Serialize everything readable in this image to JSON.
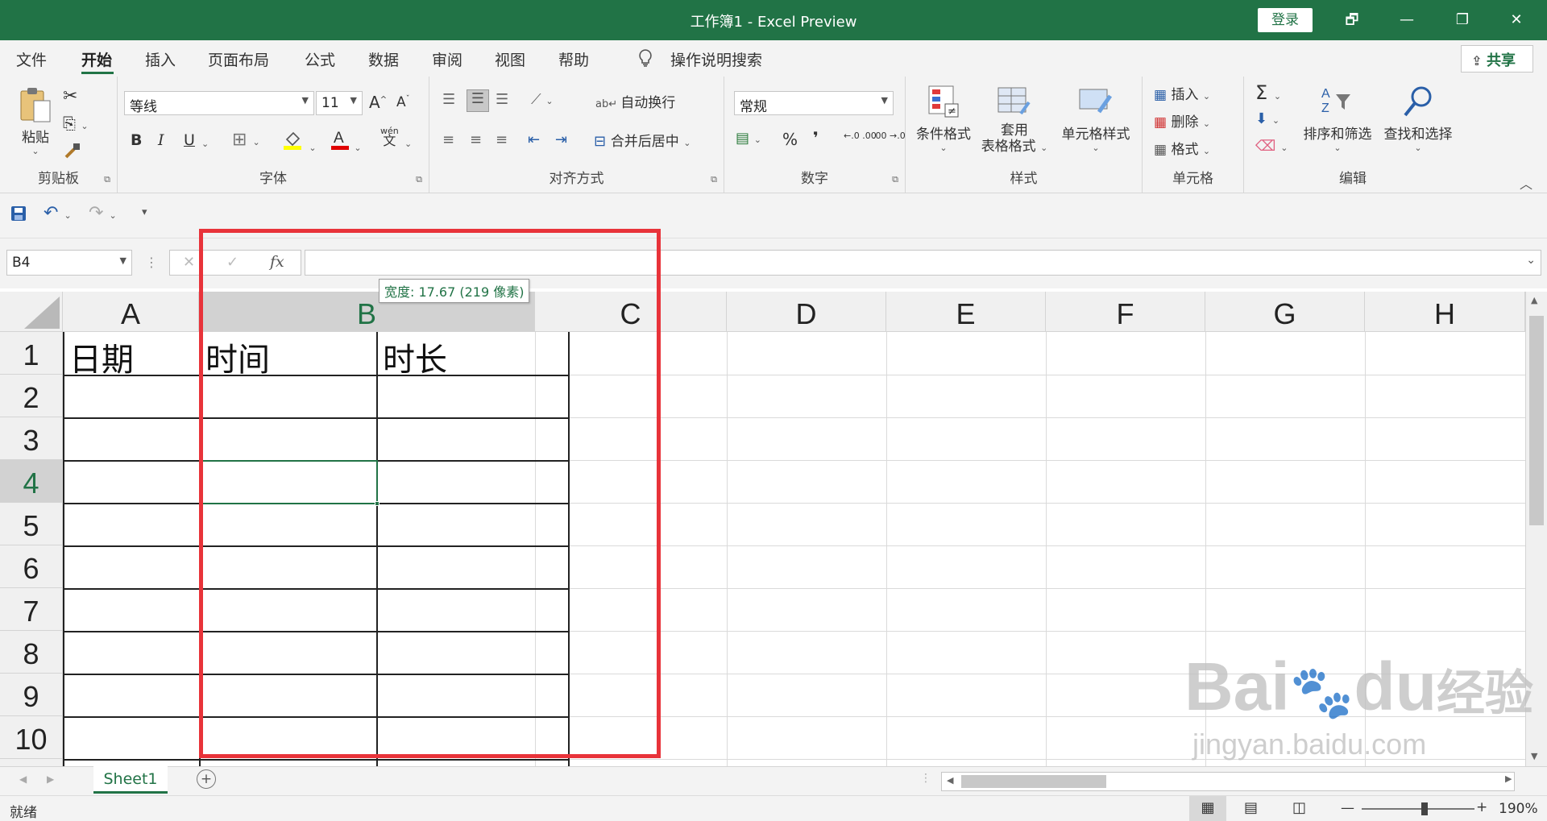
{
  "window": {
    "title": "工作簿1  -  Excel Preview",
    "login": "登录",
    "restore": "🗗",
    "minimize": "—",
    "maximize": "❐",
    "close": "✕"
  },
  "menu": {
    "tabs": [
      "文件",
      "开始",
      "插入",
      "页面布局",
      "公式",
      "数据",
      "审阅",
      "视图",
      "帮助"
    ],
    "active": "开始",
    "search_icon": "lightbulb-icon",
    "search_label": "操作说明搜索",
    "share": "共享"
  },
  "ribbon": {
    "clipboard": {
      "label": "剪贴板",
      "paste": "粘贴"
    },
    "font": {
      "label": "字体",
      "name": "等线",
      "size": "11",
      "bold": "B",
      "italic": "I",
      "underline": "U",
      "grow": "A",
      "shrink": "A",
      "phonetic_top": "wén",
      "phonetic_bottom": "文"
    },
    "alignment": {
      "label": "对齐方式",
      "wrap": "自动换行",
      "merge": "合并后居中"
    },
    "number": {
      "label": "数字",
      "format": "常规",
      "percent": "%",
      "comma": "❜",
      "inc_decimal": "←.0 .00",
      "dec_decimal": ".00 →.0"
    },
    "styles": {
      "label": "样式",
      "conditional": "条件格式",
      "table_line1": "套用",
      "table_line2": "表格格式",
      "cell_styles": "单元格样式"
    },
    "cells": {
      "label": "单元格",
      "insert": "插入",
      "delete": "删除",
      "format": "格式"
    },
    "editing": {
      "label": "编辑",
      "sum": "Σ",
      "sort": "排序和筛选",
      "find": "查找和选择"
    }
  },
  "formula_bar": {
    "name_box": "B4",
    "fx": "fx",
    "cancel": "✕",
    "enter": "✓",
    "value": ""
  },
  "grid": {
    "columns": [
      "A",
      "B",
      "C",
      "D",
      "E",
      "F",
      "G",
      "H"
    ],
    "rows": [
      "1",
      "2",
      "3",
      "4",
      "5",
      "6",
      "7",
      "8",
      "9",
      "10"
    ],
    "selected_col": "B",
    "selected_row": "4",
    "cells": {
      "A1": "日期",
      "B1": "时间",
      "C1": "时长"
    },
    "tooltip": "宽度: 17.67 (219 像素)"
  },
  "sheets": {
    "tabs": [
      "Sheet1"
    ],
    "add": "+"
  },
  "status": {
    "ready": "就绪",
    "zoom": "190%",
    "zoom_minus": "—",
    "zoom_plus": "+"
  },
  "watermark": {
    "brand": "Bai",
    "paw": "🐾",
    "brand2": "du",
    "cn": "经验",
    "url": "jingyan.baidu.com"
  }
}
